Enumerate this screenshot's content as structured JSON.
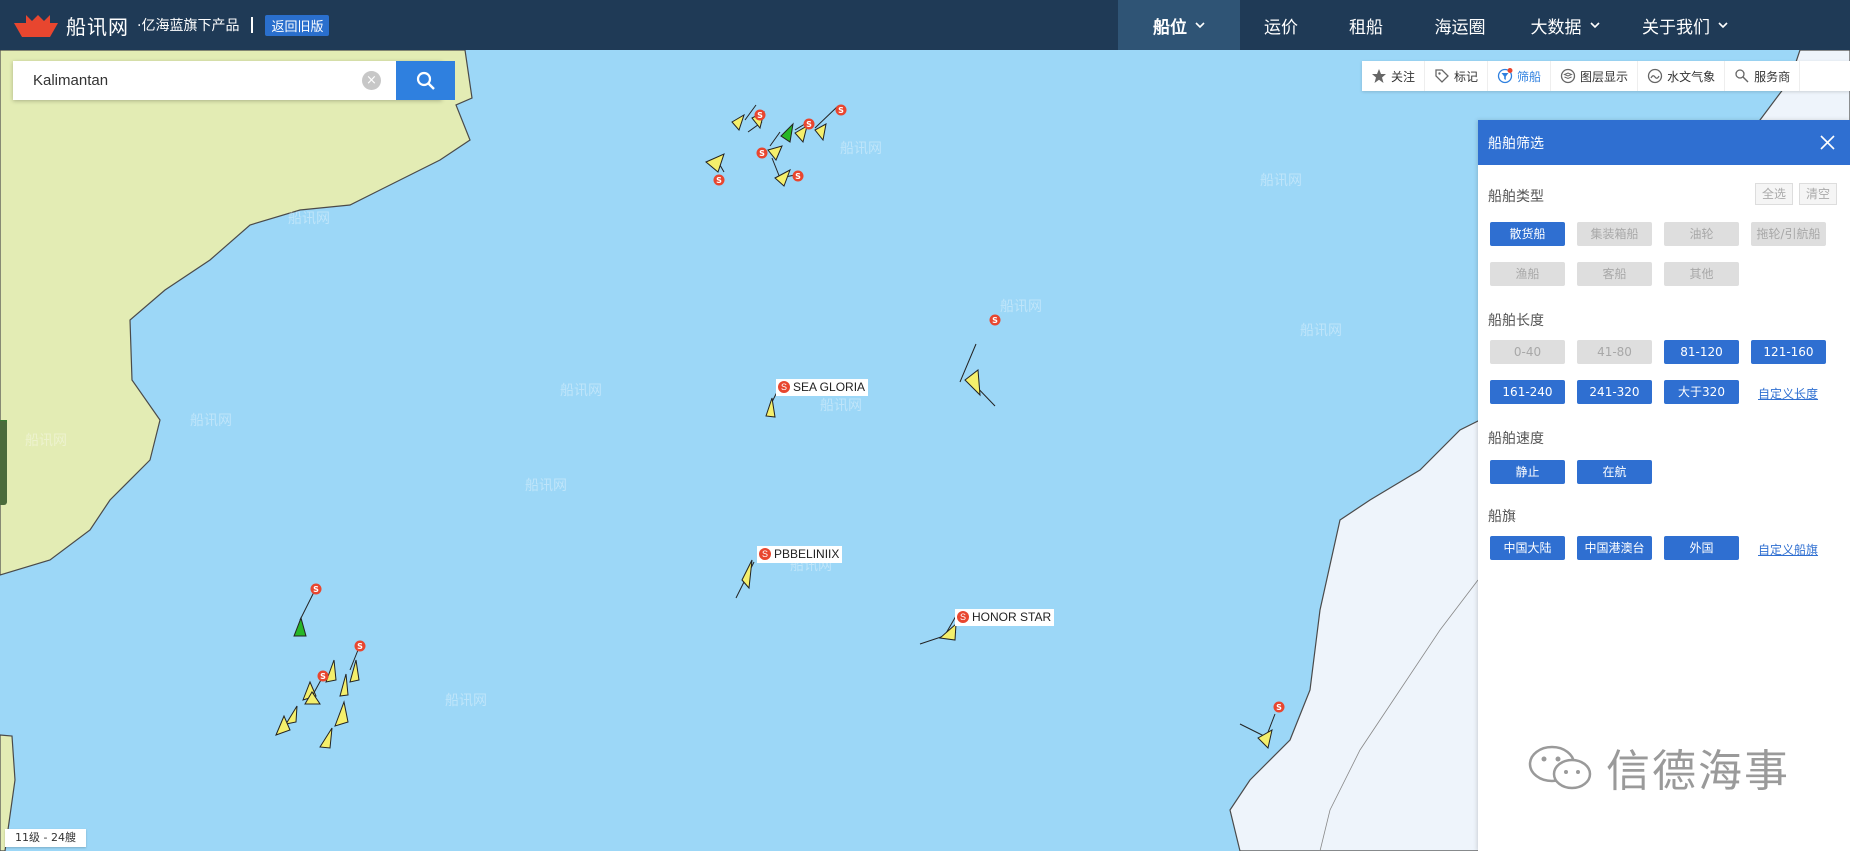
{
  "header": {
    "logo_name": "船讯网",
    "logo_sub": "·亿海蓝旗下产品",
    "old_version": "返回旧版",
    "nav": [
      {
        "label": "船位",
        "active": true,
        "dropdown": true
      },
      {
        "label": "运价",
        "active": false,
        "dropdown": false
      },
      {
        "label": "租船",
        "active": false,
        "dropdown": false
      },
      {
        "label": "海运圈",
        "active": false,
        "dropdown": false
      },
      {
        "label": "大数据",
        "active": false,
        "dropdown": true
      },
      {
        "label": "关于我们",
        "active": false,
        "dropdown": true
      }
    ]
  },
  "search": {
    "value": "Kalimantan",
    "placeholder": ""
  },
  "toolbar": {
    "items": [
      {
        "label": "关注",
        "icon": "star-icon"
      },
      {
        "label": "标记",
        "icon": "tag-icon"
      },
      {
        "label": "筛船",
        "icon": "filter-icon",
        "active": true
      },
      {
        "label": "图层显示",
        "icon": "layers-icon"
      },
      {
        "label": "水文气象",
        "icon": "weather-icon"
      },
      {
        "label": "服务商",
        "icon": "service-icon"
      }
    ]
  },
  "panel": {
    "title": "船舶筛选",
    "select_all": "全选",
    "clear": "清空",
    "type_title": "船舶类型",
    "types": [
      {
        "label": "散货船",
        "on": true
      },
      {
        "label": "集装箱船",
        "on": false
      },
      {
        "label": "油轮",
        "on": false
      },
      {
        "label": "拖轮/引航船",
        "on": false
      },
      {
        "label": "渔船",
        "on": false
      },
      {
        "label": "客船",
        "on": false
      },
      {
        "label": "其他",
        "on": false
      }
    ],
    "length_title": "船舶长度",
    "lengths": [
      {
        "label": "0-40",
        "on": false
      },
      {
        "label": "41-80",
        "on": false
      },
      {
        "label": "81-120",
        "on": true
      },
      {
        "label": "121-160",
        "on": true
      },
      {
        "label": "161-240",
        "on": true
      },
      {
        "label": "241-320",
        "on": true
      },
      {
        "label": "大于320",
        "on": true
      }
    ],
    "length_custom": "自定义长度",
    "speed_title": "船舶速度",
    "speeds": [
      {
        "label": "静止",
        "on": true
      },
      {
        "label": "在航",
        "on": true
      }
    ],
    "flag_title": "船旗",
    "flags": [
      {
        "label": "中国大陆",
        "on": true
      },
      {
        "label": "中国港澳台",
        "on": true
      },
      {
        "label": "外国",
        "on": true
      }
    ],
    "flag_custom": "自定义船旗"
  },
  "ship_labels": [
    {
      "name": "SEA GLORIA",
      "badge": "S"
    },
    {
      "name": "PBBELINIIX",
      "badge": "S"
    },
    {
      "name": "HONOR STAR",
      "badge": "S"
    }
  ],
  "status": {
    "zoom": "11级 - 24艘"
  },
  "watermark": {
    "text": "信德海事"
  },
  "colors": {
    "sea": "#9cd7f7",
    "land": "#e3ecb4",
    "nav_bg": "#1f3a56",
    "accent": "#2f6fd1",
    "ship": "#f4ef6c",
    "ship_green": "#27b727",
    "badge": "#e8462f"
  }
}
